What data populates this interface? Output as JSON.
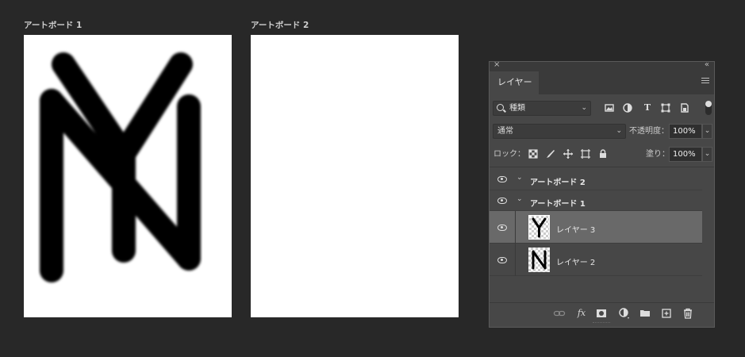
{
  "artboards": [
    {
      "title": "アートボード 1"
    },
    {
      "title": "アートボード 2"
    }
  ],
  "panel": {
    "close_glyph": "×",
    "collapse_glyph": "«",
    "tab_label": "レイヤー",
    "filter_value": "種類",
    "filter_icons": [
      "image-filter-icon",
      "adjustment-filter-icon",
      "type-filter-icon",
      "shape-filter-icon",
      "smart-object-filter-icon"
    ],
    "blend_mode": "通常",
    "opacity_label": "不透明度：",
    "opacity_value": "100%",
    "lock_label": "ロック：",
    "fill_label": "塗り：",
    "fill_value": "100%",
    "layers": [
      {
        "name": "アートボード 2",
        "type": "group"
      },
      {
        "name": "アートボード 1",
        "type": "group"
      },
      {
        "name": "レイヤー 3",
        "type": "layer",
        "thumb_letter": "Y",
        "selected": true
      },
      {
        "name": "レイヤー 2",
        "type": "layer",
        "thumb_letter": "N",
        "selected": false
      }
    ],
    "bottom_icons": [
      "link-icon",
      "fx-icon",
      "mask-icon",
      "adjustment-icon",
      "folder-icon",
      "new-layer-icon",
      "trash-icon"
    ],
    "fx_label": "fx"
  },
  "colors": {
    "background": "#282828",
    "panel": "#474747",
    "selected_row": "#696969",
    "artboard": "#ffffff"
  }
}
